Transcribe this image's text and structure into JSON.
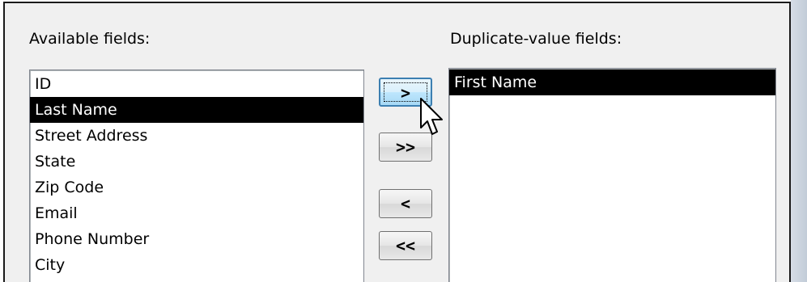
{
  "dialog": {
    "available_label": "Available fields:",
    "duplicate_label": "Duplicate-value fields:"
  },
  "available_fields": {
    "items": [
      {
        "label": "ID",
        "selected": false
      },
      {
        "label": "Last Name",
        "selected": true
      },
      {
        "label": "Street Address",
        "selected": false
      },
      {
        "label": "State",
        "selected": false
      },
      {
        "label": "Zip Code",
        "selected": false
      },
      {
        "label": "Email",
        "selected": false
      },
      {
        "label": "Phone Number",
        "selected": false
      },
      {
        "label": "City",
        "selected": false
      }
    ]
  },
  "duplicate_fields": {
    "items": [
      {
        "label": "First Name",
        "selected": true
      }
    ]
  },
  "buttons": {
    "add": ">",
    "add_all": ">>",
    "remove": "<",
    "remove_all": "<<"
  },
  "colors": {
    "selection_bg": "#000000",
    "selection_fg": "#ffffff",
    "hover_button_border": "#3c7fb1"
  },
  "icons": {
    "cursor": "arrow-cursor-icon"
  }
}
